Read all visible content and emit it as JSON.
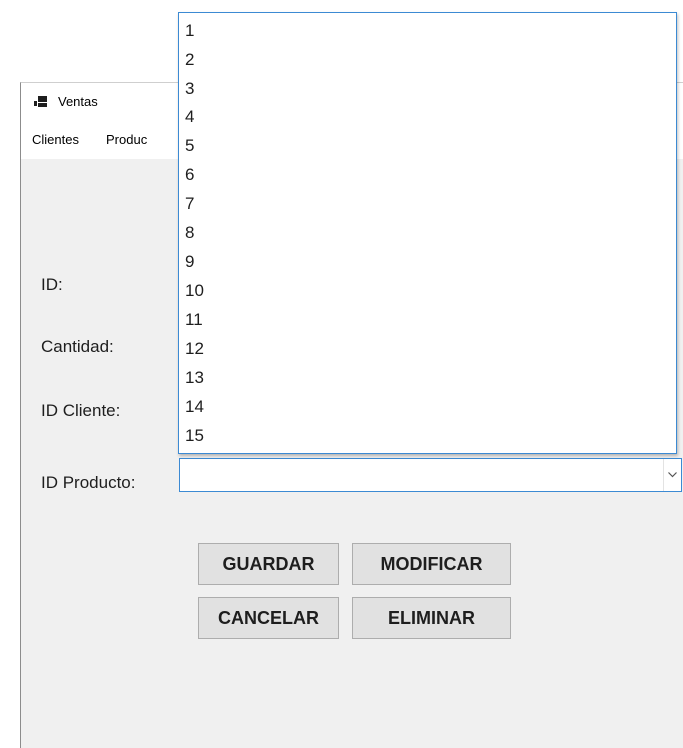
{
  "window": {
    "title": "Ventas",
    "icon": "app-window-icon"
  },
  "menu": {
    "items": [
      {
        "label": "Clientes"
      },
      {
        "label": "Productos",
        "visible_text": "Produc"
      }
    ]
  },
  "form": {
    "fields": [
      {
        "label": "ID:"
      },
      {
        "label": "Cantidad:"
      },
      {
        "label": "ID Cliente:"
      },
      {
        "label": "ID Producto:"
      }
    ],
    "producto_combo": {
      "value": "",
      "options": [
        "1",
        "2",
        "3",
        "4",
        "5",
        "6",
        "7",
        "8",
        "9",
        "10",
        "11",
        "12",
        "13",
        "14",
        "15"
      ],
      "expanded": true,
      "arrow_icon": "chevron-down-icon"
    }
  },
  "buttons": {
    "guardar": "GUARDAR",
    "modificar": "MODIFICAR",
    "cancelar": "CANCELAR",
    "eliminar": "ELIMINAR"
  },
  "colors": {
    "focus_border": "#3c8ad3",
    "window_background": "#f0f0f0",
    "button_background": "#e1e1e1"
  }
}
